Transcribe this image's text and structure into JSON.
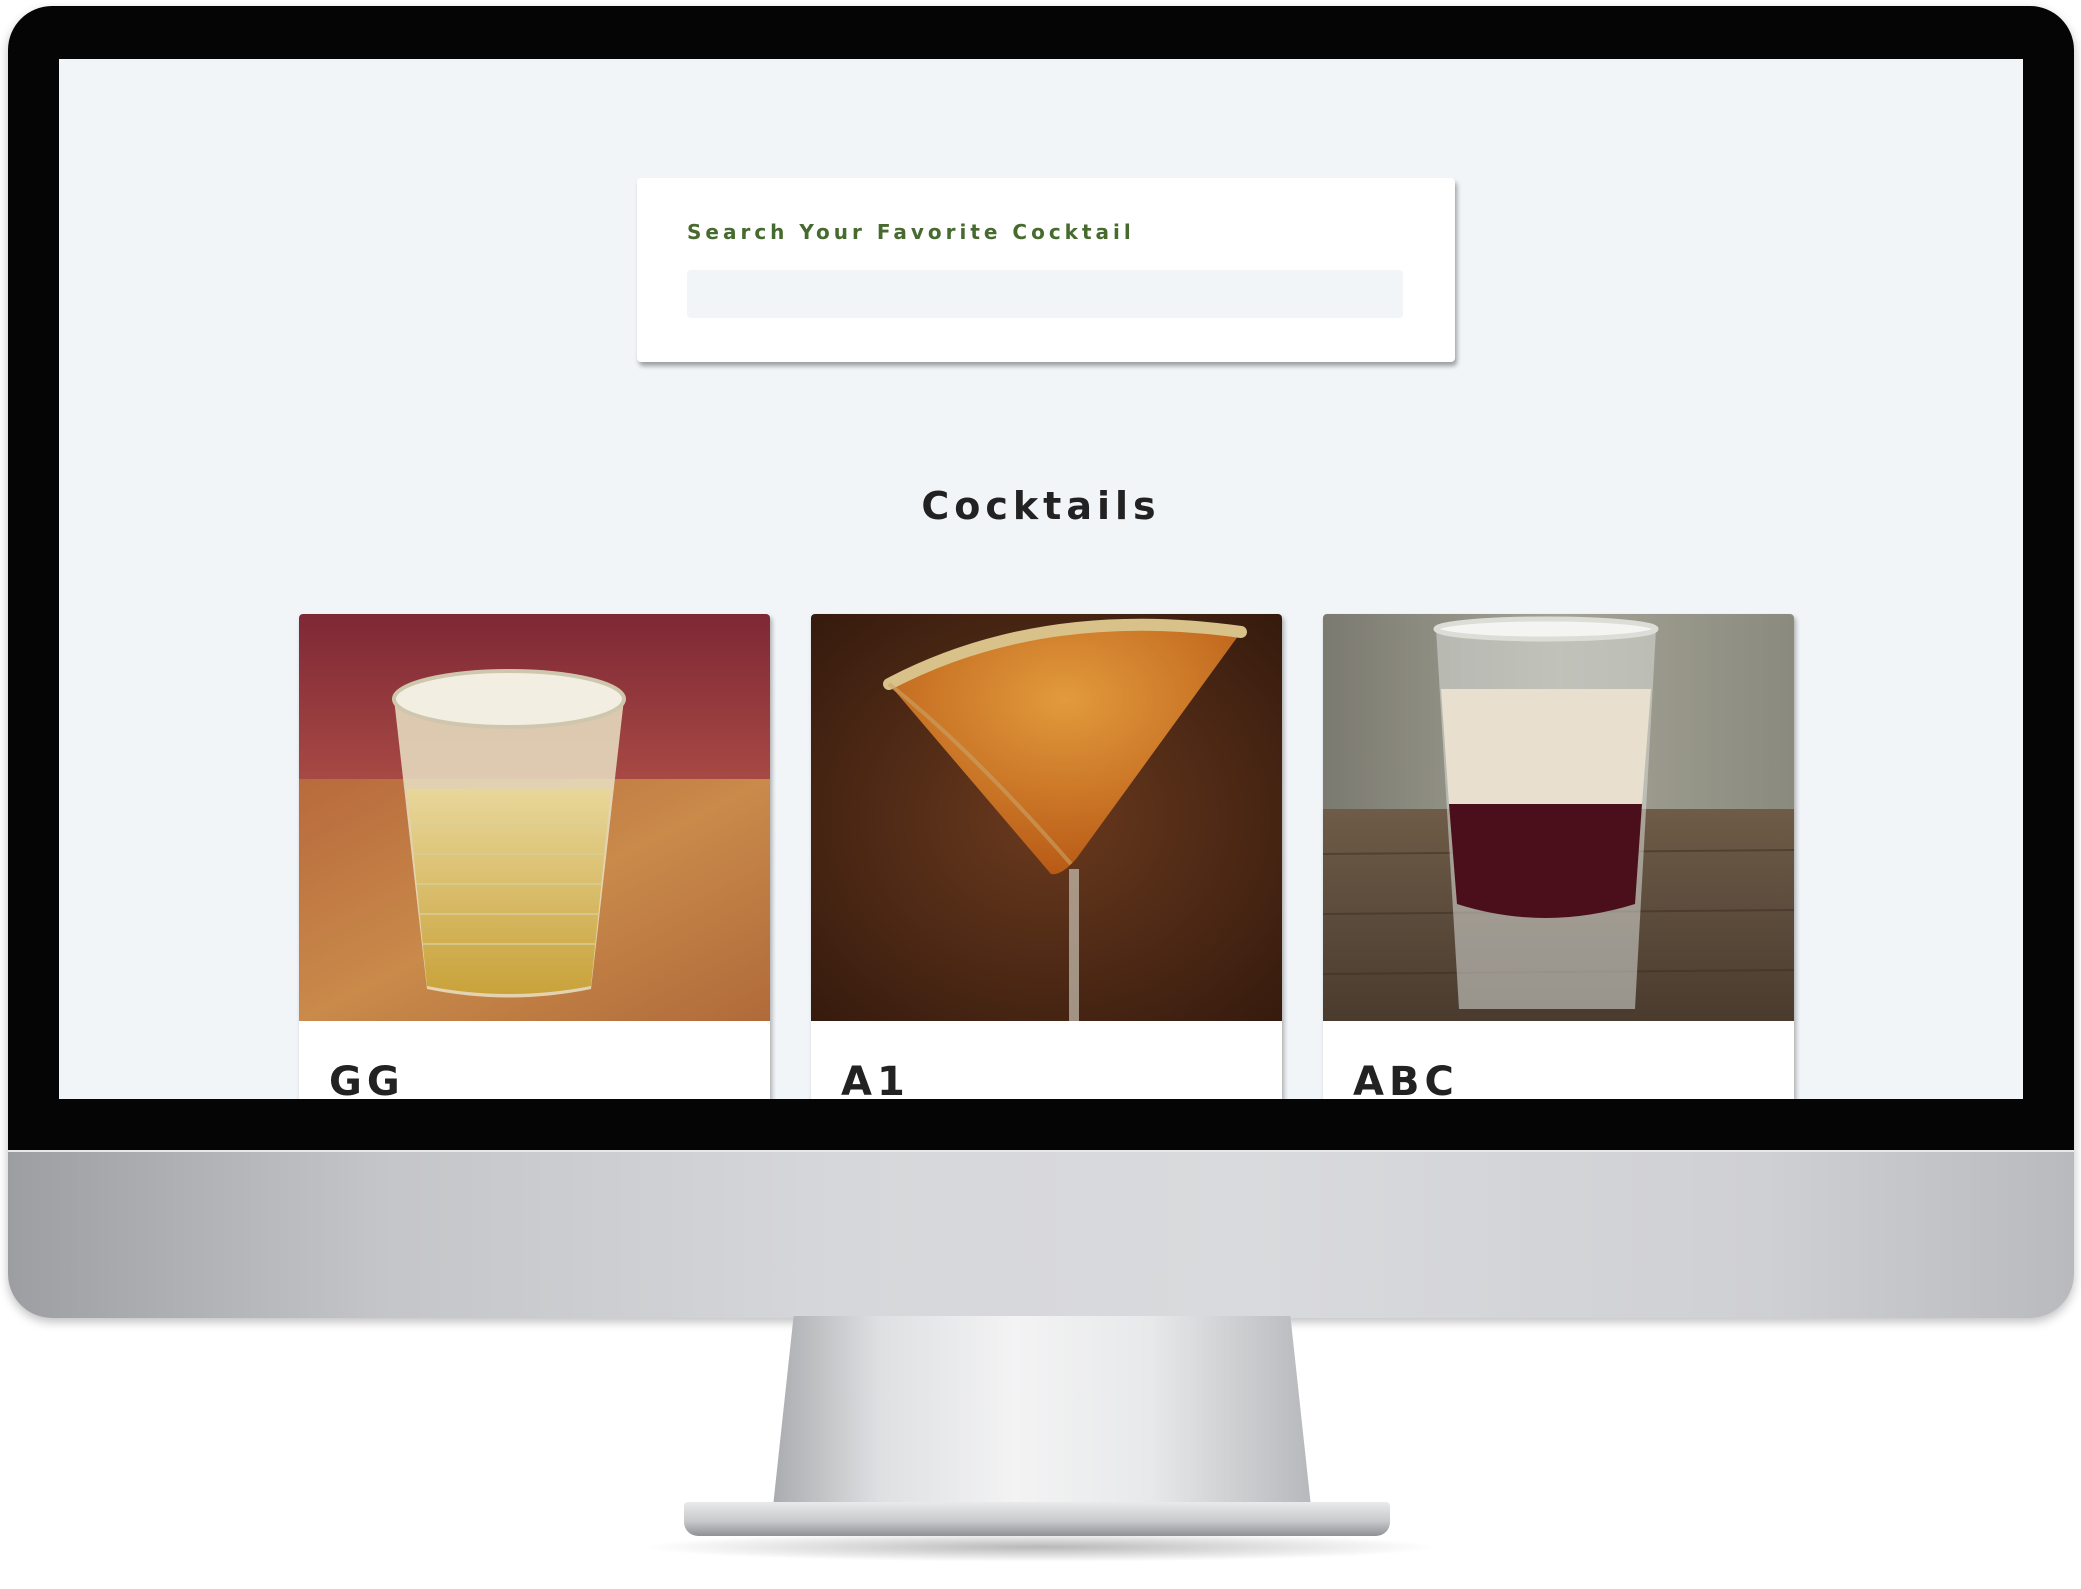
{
  "search": {
    "label": "Search Your Favorite Cocktail",
    "value": ""
  },
  "section": {
    "title": "Cocktails"
  },
  "cocktails": [
    {
      "name": "GG",
      "image": "old-fashioned glass of pale golden drink on a tan surface against a maroon wall"
    },
    {
      "name": "A1",
      "image": "martini glass with orange cocktail and sugared rim on a dark wooden background"
    },
    {
      "name": "ABC",
      "image": "layered shot glass with cream top and dark red bottom, salted rim, on wooden table"
    }
  ],
  "colors": {
    "page_background": "#f1f5f8",
    "search_label": "#476a2e",
    "heading_text": "#222222"
  }
}
